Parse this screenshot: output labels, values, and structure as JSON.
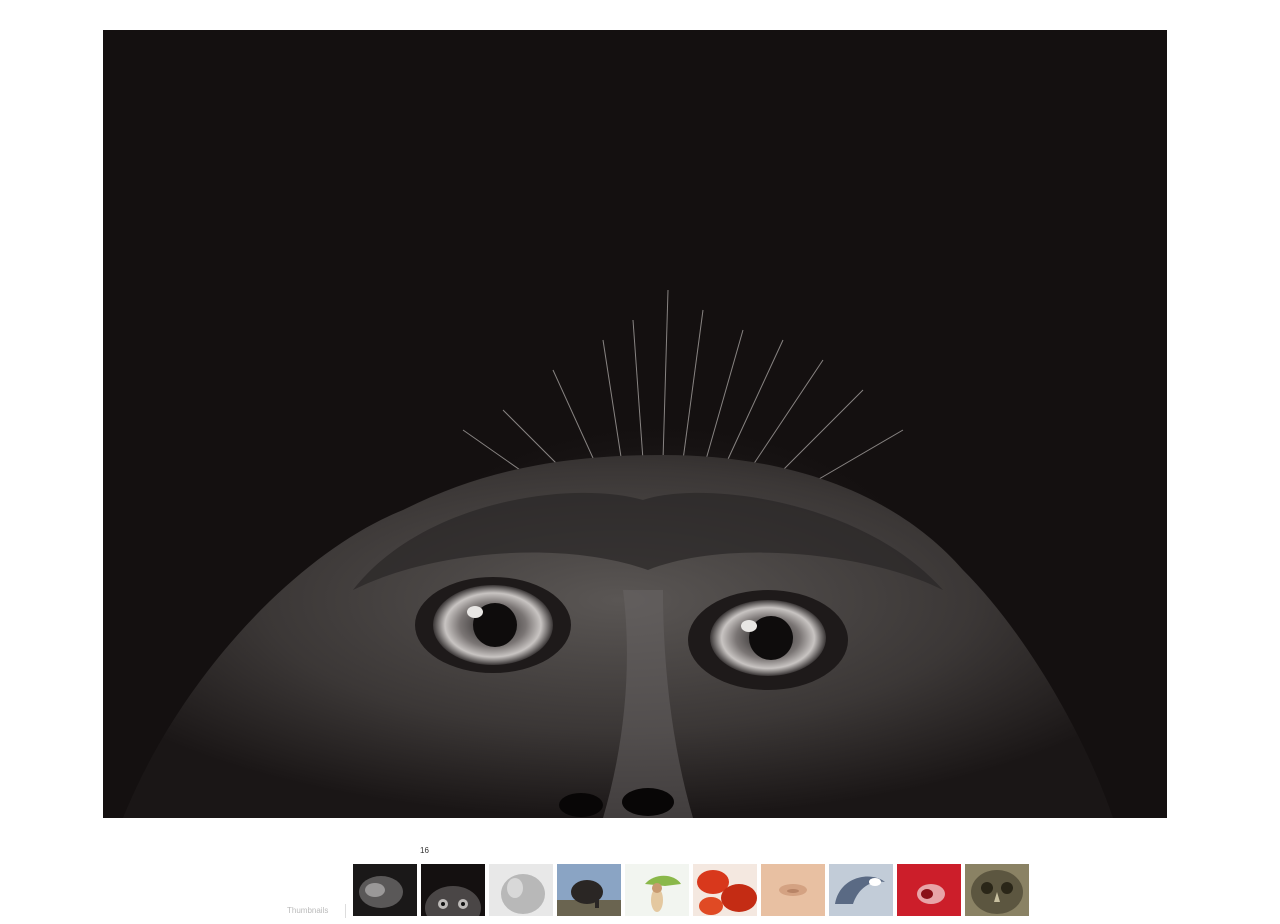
{
  "viewer": {
    "image_subject": "monkey-face-photo",
    "background_color": "#141010"
  },
  "gallery": {
    "counter": "16",
    "thumbnails_label": "Thumbnails",
    "thumbnails": [
      {
        "subject": "bw-animal",
        "color": "#3a3a3a"
      },
      {
        "subject": "bw-monkey",
        "color": "#2a2a2a"
      },
      {
        "subject": "white-horse",
        "color": "#cfcfcf"
      },
      {
        "subject": "elephant-sky",
        "color": "#6c86a8"
      },
      {
        "subject": "green-bird",
        "color": "#e8efe6"
      },
      {
        "subject": "red-peppers",
        "color": "#d2361c"
      },
      {
        "subject": "skin-tone",
        "color": "#e4b89a"
      },
      {
        "subject": "grey-blue-shape",
        "color": "#a9b4c4"
      },
      {
        "subject": "red-abstract",
        "color": "#c8202c"
      },
      {
        "subject": "owl-face",
        "color": "#7c7558"
      }
    ]
  }
}
